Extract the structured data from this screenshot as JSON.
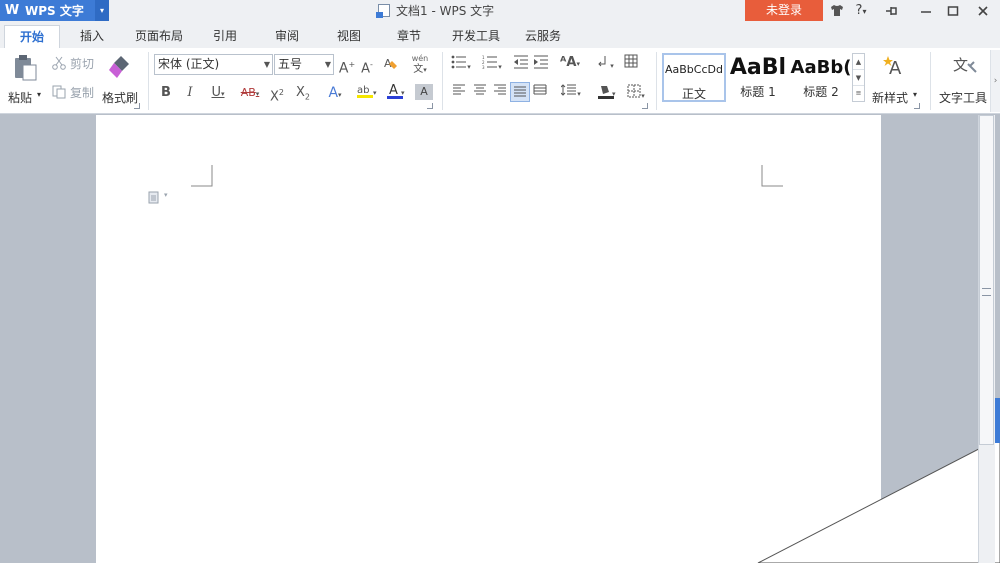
{
  "app": {
    "logo": "W",
    "name": "WPS 文字",
    "menu_caret": "▾"
  },
  "window": {
    "title": "文档1 - WPS 文字",
    "login": "未登录",
    "help": "?",
    "controls": [
      "shirt-icon",
      "help-icon",
      "pin-icon",
      "minimize-icon",
      "maximize-icon",
      "close-icon"
    ]
  },
  "tabs": [
    "开始",
    "插入",
    "页面布局",
    "引用",
    "审阅",
    "视图",
    "章节",
    "开发工具",
    "云服务"
  ],
  "clipboard": {
    "paste": "粘贴",
    "cut": "剪切",
    "copy": "复制",
    "format_painter": "格式刷"
  },
  "font": {
    "family": "宋体 (正文)",
    "size": "五号"
  },
  "styles": [
    {
      "sample": "AaBbCcDd",
      "caption": "正文"
    },
    {
      "sample": "AaBl",
      "caption": "标题 1"
    },
    {
      "sample": "AaBb(",
      "caption": "标题 2"
    }
  ],
  "new_style": "新样式",
  "text_tools": "文字工具",
  "colors": {
    "accent": "#3d7bd6",
    "login": "#e85d3b",
    "highlight": "#f5e600",
    "font_color": "#2b3fd6"
  }
}
